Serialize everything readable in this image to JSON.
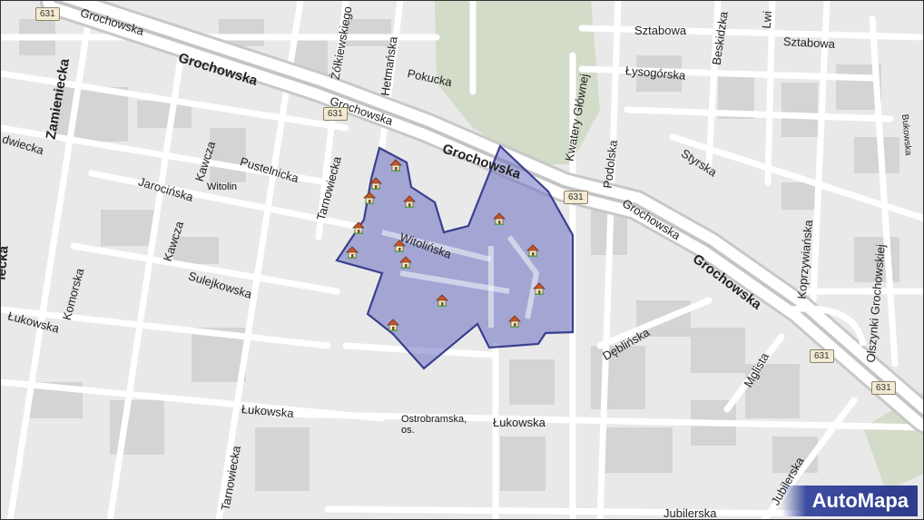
{
  "map": {
    "streets": [
      {
        "id": "grochowska-1",
        "text": "Grochowska",
        "big": false
      },
      {
        "id": "grochowska-2",
        "text": "Grochowska",
        "big": true
      },
      {
        "id": "grochowska-3",
        "text": "Grochowska",
        "big": false
      },
      {
        "id": "grochowska-4",
        "text": "Grochowska",
        "big": true
      },
      {
        "id": "grochowska-5",
        "text": "Grochowska",
        "big": false
      },
      {
        "id": "grochowska-6",
        "text": "Grochowska",
        "big": true
      },
      {
        "id": "zamieniecka",
        "text": "Zamieniecka",
        "big": true
      },
      {
        "id": "zolkiewskiego",
        "text": "Żółkiewskiego",
        "big": false
      },
      {
        "id": "hetmanska",
        "text": "Hetmańska",
        "big": false
      },
      {
        "id": "pokucka",
        "text": "Pokucka",
        "big": false
      },
      {
        "id": "kwatery",
        "text": "Kwatery Głównej",
        "big": false
      },
      {
        "id": "podolska",
        "text": "Podolska",
        "big": false
      },
      {
        "id": "sztabowa-1",
        "text": "Sztabowa",
        "big": false
      },
      {
        "id": "sztabowa-2",
        "text": "Sztabowa",
        "big": false
      },
      {
        "id": "beskidzka",
        "text": "Beskidzka",
        "big": false
      },
      {
        "id": "lwowska",
        "text": "Lwi",
        "big": false
      },
      {
        "id": "lysogorska",
        "text": "Łysogórska",
        "big": false
      },
      {
        "id": "styrska",
        "text": "Styrska",
        "big": false
      },
      {
        "id": "dwiecka",
        "text": "dwiecka",
        "big": false
      },
      {
        "id": "kawcza-1",
        "text": "Kawcza",
        "big": false
      },
      {
        "id": "kawcza-2",
        "text": "Kawcza",
        "big": false
      },
      {
        "id": "pustelnicka",
        "text": "Pustelnicka",
        "big": false
      },
      {
        "id": "tarnowiecka-1",
        "text": "Tarnowiecka",
        "big": false
      },
      {
        "id": "tarnowiecka-2",
        "text": "Tarnowiecka",
        "big": false
      },
      {
        "id": "jarocinska",
        "text": "Jarocińska",
        "big": false
      },
      {
        "id": "witolinska",
        "text": "Witolińska",
        "big": false
      },
      {
        "id": "sulejkowska",
        "text": "Sulejkowska",
        "big": false
      },
      {
        "id": "komorska",
        "text": "Komorska",
        "big": false
      },
      {
        "id": "lukowska-1",
        "text": "Łukowska",
        "big": false
      },
      {
        "id": "lukowska-2",
        "text": "Łukowska",
        "big": false
      },
      {
        "id": "lukowska-3",
        "text": "Łukowska",
        "big": false
      },
      {
        "id": "deblinska",
        "text": "Dęblińska",
        "big": false
      },
      {
        "id": "mglista",
        "text": "Mglista",
        "big": false
      },
      {
        "id": "koprzywianska",
        "text": "Koprzywiańska",
        "big": false
      },
      {
        "id": "olszynki",
        "text": "Olszynki Grochowskiej",
        "big": false
      },
      {
        "id": "jubilerska-1",
        "text": "Jubilerska",
        "big": false
      },
      {
        "id": "jubilerska-2",
        "text": "Jubilerska",
        "big": false
      },
      {
        "id": "left-edge",
        "text": "iecka",
        "big": true
      },
      {
        "id": "right-edge",
        "text": "Bukowska",
        "big": false
      }
    ],
    "places": [
      {
        "id": "witolin",
        "text": "Witolin"
      },
      {
        "id": "ostrobramska-1",
        "text": "Ostrobramska,"
      },
      {
        "id": "ostrobramska-2",
        "text": "os."
      }
    ],
    "road_number": "631",
    "road_shields": [
      "631",
      "631",
      "631",
      "631",
      "631"
    ],
    "poi_icon": "house-icon",
    "poi_count": 15,
    "area_fill": "#6a6fbf",
    "area_stroke": "#3a3f8f"
  },
  "brand": {
    "logo_text": "AutoMapa",
    "color": "#2d3b8c"
  }
}
